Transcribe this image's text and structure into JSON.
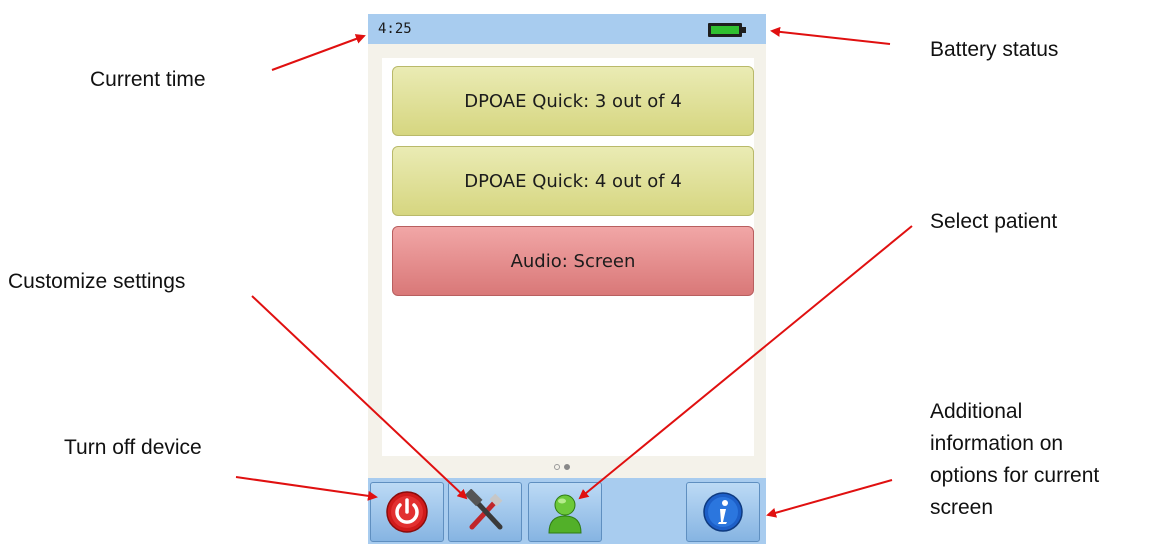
{
  "status_bar": {
    "time": "4:25"
  },
  "test_list": [
    {
      "label": "DPOAE Quick: 3 out of 4",
      "status_color": "#d9d986"
    },
    {
      "label": "DPOAE Quick: 4 out of 4",
      "status_color": "#d9d986"
    },
    {
      "label": "Audio: Screen",
      "status_color": "#dc7e7e"
    }
  ],
  "bottom_bar": {
    "icons": [
      "power-icon",
      "tools-icon",
      "patient-icon",
      "info-icon"
    ]
  },
  "annotations": {
    "current_time": "Current time",
    "battery_status": "Battery status",
    "customize_settings": "Customize settings",
    "select_patient": "Select patient",
    "turn_off_device": "Turn off device",
    "additional_info": [
      "Additional",
      "information on",
      "options for current",
      "screen"
    ]
  },
  "colors": {
    "annotation_arrow": "#e01010",
    "bar_blue": "#a8ccef"
  }
}
